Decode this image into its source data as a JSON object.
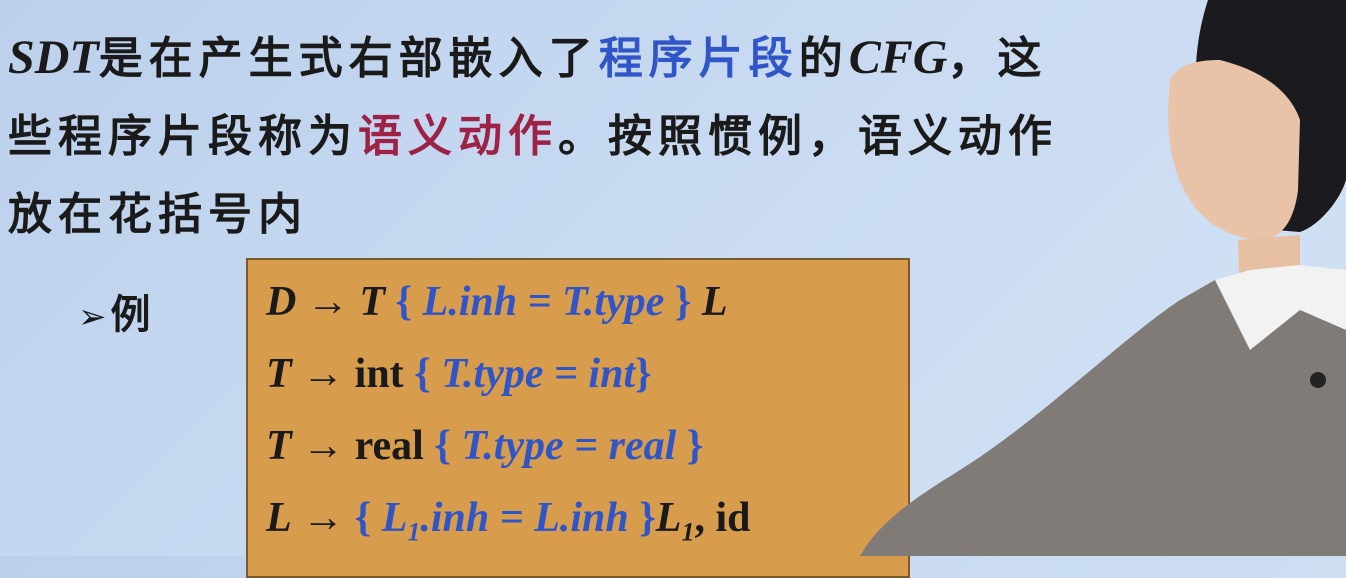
{
  "text": {
    "line1_a": "SDT",
    "line1_b": "是在产生式右部嵌入了",
    "line1_c": "程序片段",
    "line1_d": "的",
    "line1_e": "CFG",
    "line1_f": "，这",
    "line2_a": "些程序片段称为",
    "line2_b": "语义动作",
    "line2_c": "。按照惯例，语义动作",
    "line3": "放在花括号内",
    "bullet_arrow": "➢",
    "bullet_label": "例"
  },
  "rules": [
    {
      "lhs": "D",
      "arrow": "→",
      "pre": "T",
      "action": "L.inh = T.type",
      "post": "L"
    },
    {
      "lhs": "T",
      "arrow": "→",
      "pre": "int",
      "action": "T.type = int",
      "post": ""
    },
    {
      "lhs": "T",
      "arrow": "→",
      "pre": "real",
      "action": "T.type = real",
      "post": ""
    },
    {
      "lhs": "L",
      "arrow": "→",
      "pre": "",
      "action_a": "L",
      "action_sub": "1",
      "action_b": ".inh = L.inh",
      "post_a": "L",
      "post_sub": "1",
      "post_b": ", id"
    }
  ],
  "colors": {
    "action_blue": "#2f55c8",
    "term_red": "#9e2146",
    "box_fill": "#d79d4c"
  }
}
